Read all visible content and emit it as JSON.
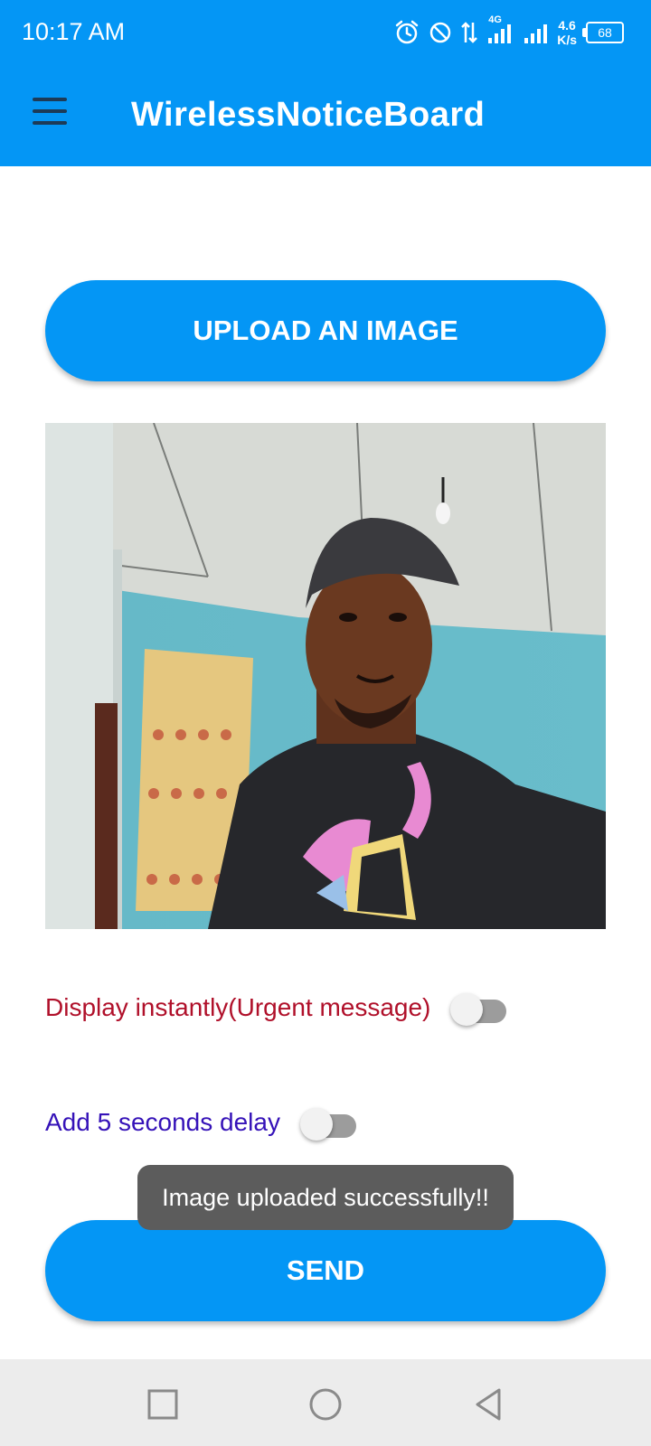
{
  "status_bar": {
    "time": "10:17 AM",
    "network_label": "4G",
    "speed_value": "4.6",
    "speed_unit": "K/s",
    "battery": "68"
  },
  "app_bar": {
    "title": "WirelessNoticeBoard",
    "menu_icon": "hamburger-menu-icon"
  },
  "upload_button": {
    "label": "UPLOAD AN IMAGE"
  },
  "preview": {
    "content": "selfie photo of a man in a black cap and black t-shirt"
  },
  "options": [
    {
      "label": "Display instantly(Urgent message)",
      "checked": false,
      "color": "#b0102a"
    },
    {
      "label": "Add 5 seconds delay",
      "checked": false,
      "color": "#3512b8"
    }
  ],
  "toast": {
    "message": "Image uploaded successfully!!"
  },
  "send_button": {
    "label": "SEND"
  },
  "colors": {
    "primary": "#0496f5",
    "toast_bg": "#5c5c5c",
    "nav_bg": "#ececec"
  },
  "nav_bar": {
    "icons": [
      "recent-apps-icon",
      "home-icon",
      "back-icon"
    ]
  }
}
